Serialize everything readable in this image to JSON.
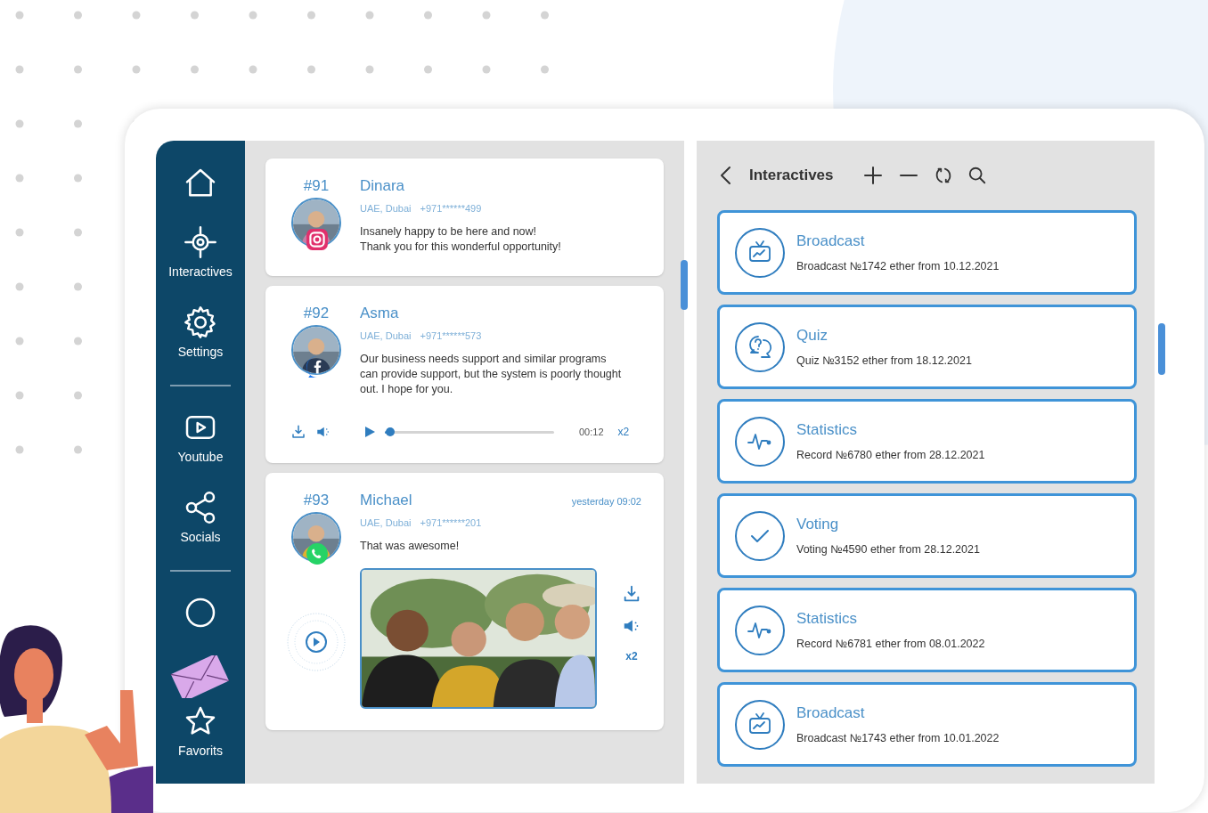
{
  "sidebar": {
    "items": [
      {
        "kind": "home"
      },
      {
        "kind": "interactives",
        "label": "Interactives"
      },
      {
        "kind": "settings",
        "label": "Settings"
      },
      {
        "kind": "divider"
      },
      {
        "kind": "youtube",
        "label": "Youtube"
      },
      {
        "kind": "socials",
        "label": "Socials"
      },
      {
        "kind": "divider"
      },
      {
        "kind": "profile"
      },
      {
        "kind": "favorites",
        "label": "Favorits"
      }
    ]
  },
  "messages": [
    {
      "number": "#91",
      "name": "Dinara",
      "location": "UAE, Dubai",
      "phone": "+971******499",
      "text": "Insanely happy to be here and now!\nThank you for this wonderful opportunity!",
      "badge": {
        "kind": "instagram"
      }
    },
    {
      "number": "#92",
      "name": "Asma",
      "location": "UAE, Dubai",
      "phone": "+971******573",
      "text": "Our business needs support and similar programs can provide support, but the system is poorly thought out. I hope for you.",
      "badge": {
        "kind": "facebook"
      },
      "audio": {
        "level": 0.03,
        "time": "00:12",
        "speed": "x2"
      }
    },
    {
      "number": "#93",
      "name": "Michael",
      "location": "UAE, Dubai",
      "phone": "+971******201",
      "time": "yesterday 09:02",
      "text": "That was awesome!",
      "badge": {
        "kind": "whatsapp"
      },
      "video": {
        "speed": "x2"
      }
    }
  ],
  "interactives": {
    "title": "Interactives",
    "items": [
      {
        "kind": "broadcast",
        "title": "Broadcast",
        "subtitle": "Broadcast №1742 ether from 10.12.2021"
      },
      {
        "kind": "quiz",
        "title": "Quiz",
        "subtitle": "Quiz №3152 ether from 18.12.2021"
      },
      {
        "kind": "statistics",
        "title": "Statistics",
        "subtitle": "Record №6780 ether from 28.12.2021"
      },
      {
        "kind": "voting",
        "title": "Voting",
        "subtitle": "Voting №4590 ether from 28.12.2021"
      },
      {
        "kind": "statistics",
        "title": "Statistics",
        "subtitle": "Record №6781 ether from 08.01.2022"
      },
      {
        "kind": "broadcast",
        "title": "Broadcast",
        "subtitle": "Broadcast №1743 ether from 10.01.2022"
      }
    ]
  }
}
